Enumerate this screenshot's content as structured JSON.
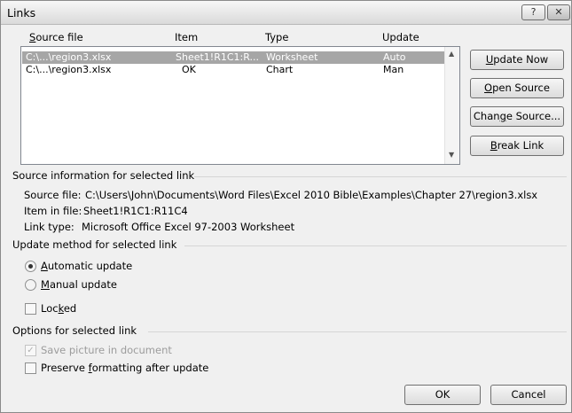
{
  "window": {
    "title": "Links",
    "help_glyph": "?",
    "close_glyph": "✕"
  },
  "list": {
    "headers": {
      "source_file": {
        "pre": "",
        "key": "S",
        "post": "ource file"
      },
      "item": "Item",
      "type": "Type",
      "update": "Update"
    },
    "rows": [
      {
        "source": "C:\\...\\region3.xlsx",
        "item": "Sheet1!R1C1:R...",
        "type": "Worksheet",
        "update": "Auto",
        "selected": true
      },
      {
        "source": "C:\\...\\region3.xlsx",
        "item": "OK",
        "type": "Chart",
        "update": "Man",
        "selected": false
      }
    ]
  },
  "buttons": {
    "update_now": {
      "pre": "",
      "key": "U",
      "post": "pdate Now"
    },
    "open_source": {
      "pre": "",
      "key": "O",
      "post": "pen Source"
    },
    "change_source": {
      "pre": "Chan",
      "key": "g",
      "post": "e Source..."
    },
    "break_link": {
      "pre": "",
      "key": "B",
      "post": "reak Link"
    },
    "ok": "OK",
    "cancel": "Cancel"
  },
  "source_info": {
    "section_title": "Source information for selected link",
    "source_file_label": "Source file:",
    "source_file_value": "C:\\Users\\John\\Documents\\Word Files\\Excel 2010 Bible\\Examples\\Chapter 27\\region3.xlsx",
    "item_label": "Item in file:",
    "item_value": "Sheet1!R1C1:R11C4",
    "link_type_label": "Link type:",
    "link_type_value": "Microsoft Office Excel 97-2003 Worksheet"
  },
  "update_method": {
    "section_title": "Update method for selected link",
    "automatic": {
      "pre": "",
      "key": "A",
      "post": "utomatic update",
      "selected": true
    },
    "manual": {
      "pre": "",
      "key": "M",
      "post": "anual update",
      "selected": false
    },
    "locked": {
      "pre": "Loc",
      "key": "k",
      "post": "ed",
      "checked": false
    }
  },
  "options": {
    "section_title": "Options for selected link",
    "save_picture": {
      "label": "Save picture in document",
      "checked": true,
      "disabled": true
    },
    "preserve": {
      "pre": "Preserve ",
      "key": "f",
      "post": "ormatting after update",
      "checked": false
    }
  }
}
